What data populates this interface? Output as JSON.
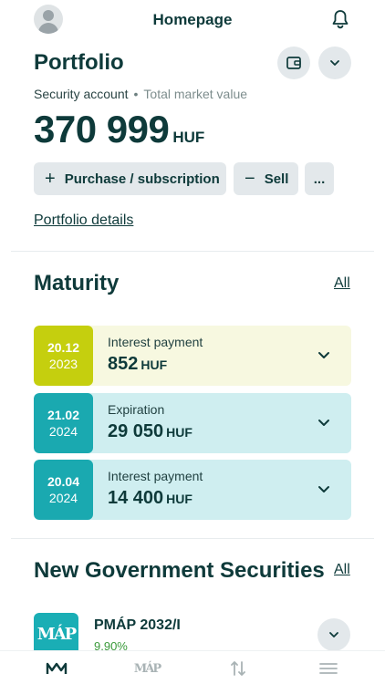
{
  "header": {
    "title": "Homepage"
  },
  "portfolio": {
    "title": "Portfolio",
    "account_label": "Security account",
    "separator": "•",
    "market_value_label": "Total market value",
    "total_value": "370 999",
    "currency": "HUF",
    "actions": {
      "purchase_label": "Purchase / subscription",
      "purchase_icon": "+",
      "sell_label": "Sell",
      "sell_icon": "−",
      "more_label": "..."
    },
    "details_link": "Portfolio details"
  },
  "maturity": {
    "title": "Maturity",
    "all_link": "All",
    "items": [
      {
        "date": "20.12",
        "year": "2023",
        "type": "Interest payment",
        "amount": "852",
        "currency": "HUF",
        "date_color": "#c5cf0e",
        "card_color": "#f7f8e0"
      },
      {
        "date": "21.02",
        "year": "2024",
        "type": "Expiration",
        "amount": "29 050",
        "currency": "HUF",
        "date_color": "#1aa9b0",
        "card_color": "#cfeef0"
      },
      {
        "date": "20.04",
        "year": "2024",
        "type": "Interest payment",
        "amount": "14 400",
        "currency": "HUF",
        "date_color": "#1aa9b0",
        "card_color": "#cfeef0"
      }
    ]
  },
  "new_securities": {
    "title": "New Government Securities",
    "all_link": "All",
    "items": [
      {
        "logo_text": "MÁP",
        "name": "PMÁP 2032/I",
        "rate": "9.90%"
      }
    ]
  },
  "tabbar": {
    "items": [
      {
        "icon": "home-logo-icon",
        "label": "ꟿ",
        "active": true
      },
      {
        "icon": "map-logo-icon",
        "label": "MÁP",
        "active": false
      },
      {
        "icon": "transfer-arrows-icon",
        "label": "",
        "active": false
      },
      {
        "icon": "menu-icon",
        "label": "",
        "active": false
      }
    ]
  }
}
